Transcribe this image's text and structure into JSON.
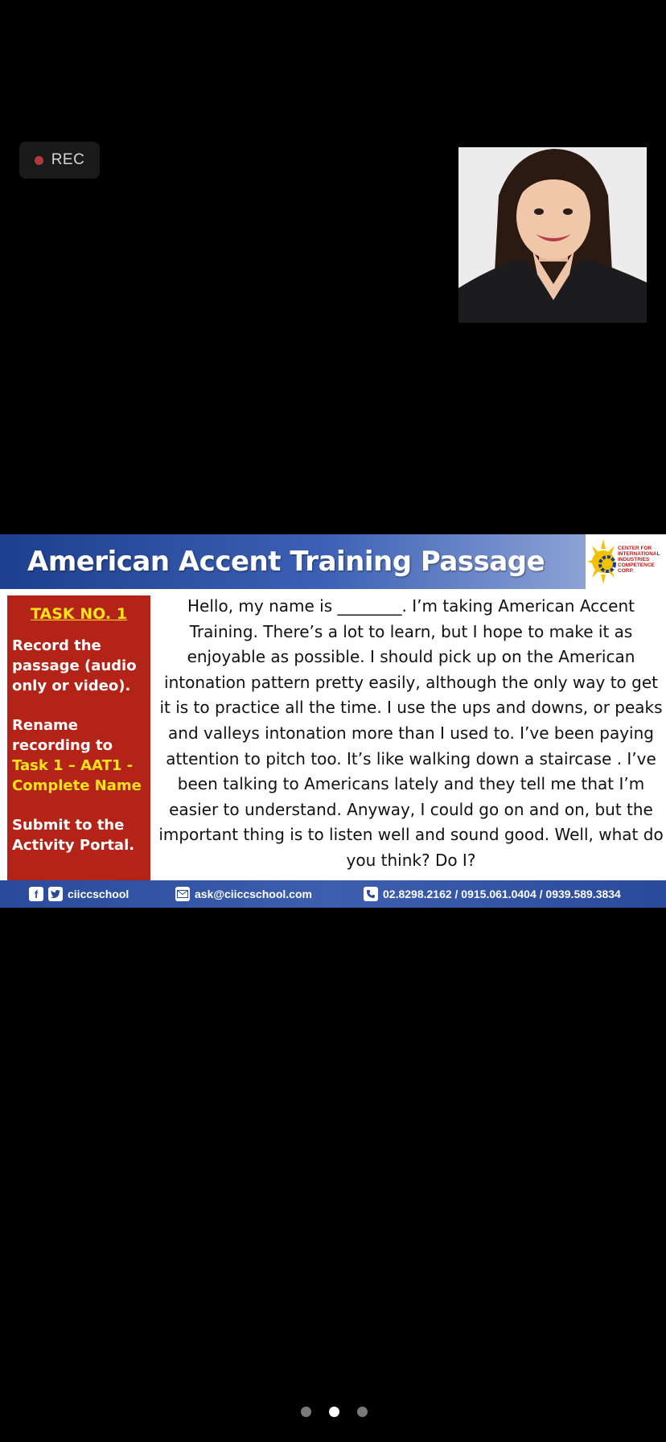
{
  "recording": {
    "label": "REC"
  },
  "slide": {
    "title": "American Accent Training Passage",
    "logo_text": "CENTER FOR INTERNATIONAL INDUSTRIES COMPETENCE CORP.",
    "task": {
      "heading": "TASK NO. 1",
      "step1": "Record the passage (audio only or video).",
      "step2_prefix": "Rename recording to",
      "step2_name": "Task 1 – AAT1 - Complete Name",
      "step3": "Submit to the Activity Portal."
    },
    "passage": "Hello, my name is ________.  I’m taking American Accent Training. There’s a lot to learn, but I hope to make it as enjoyable as possible.  I should pick up on the American intonation pattern pretty easily, although the only way to get it is to practice all the time.  I use the ups and downs, or peaks and valleys intonation more than I used to. I’ve been paying attention to pitch too. It’s like walking down a staircase . I’ve been talking to Americans lately and they tell me that I’m easier to understand. Anyway, I could go on and on, but the important thing is to listen well and sound good. Well, what do you think? Do I?",
    "footer": {
      "social": "ciiccschool",
      "email": "ask@ciiccschool.com",
      "phones": "02.8298.2162 / 0915.061.0404 / 0939.589.3834"
    }
  },
  "pager": {
    "count": 3,
    "active_index": 1
  },
  "colors": {
    "task_bg": "#b32318",
    "task_highlight": "#ffe31a",
    "header_blue": "#1d3f8e",
    "footer_blue": "#2a4a9b"
  }
}
